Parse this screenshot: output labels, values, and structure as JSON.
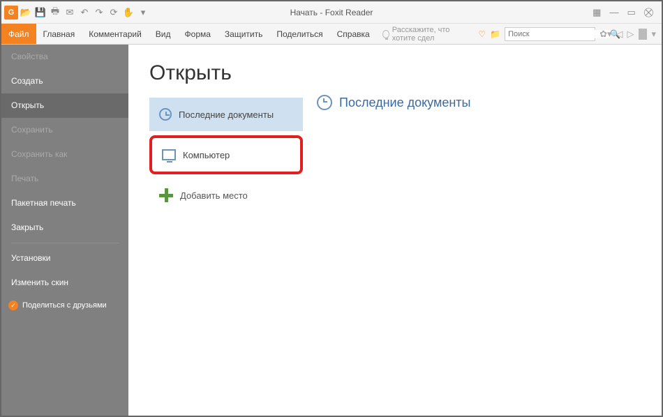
{
  "window": {
    "title": "Начать - Foxit Reader"
  },
  "ribbon": {
    "tabs": [
      {
        "label": "Файл",
        "active": true
      },
      {
        "label": "Главная"
      },
      {
        "label": "Комментарий"
      },
      {
        "label": "Вид"
      },
      {
        "label": "Форма"
      },
      {
        "label": "Защитить"
      },
      {
        "label": "Поделиться"
      },
      {
        "label": "Справка"
      }
    ],
    "tellme": "Расскажите, что хотите сдел",
    "search_placeholder": "Поиск"
  },
  "sidebar": {
    "items": [
      {
        "label": "Свойства",
        "dim": true
      },
      {
        "label": "Создать",
        "bright": true
      },
      {
        "label": "Открыть",
        "selected": true
      },
      {
        "label": "Сохранить",
        "dim": true
      },
      {
        "label": "Сохранить как",
        "dim": true
      },
      {
        "label": "Печать",
        "dim": true
      },
      {
        "label": "Пакетная печать",
        "bright": true
      },
      {
        "label": "Закрыть",
        "bright": true
      },
      {
        "label": "Установки",
        "bright": true
      },
      {
        "label": "Изменить скин",
        "bright": true
      }
    ],
    "share": "Поделиться с друзьями"
  },
  "main": {
    "heading": "Открыть",
    "locations": {
      "recent": "Последние документы",
      "computer": "Компьютер",
      "add": "Добавить место"
    },
    "content": {
      "recent_heading": "Последние документы"
    }
  }
}
